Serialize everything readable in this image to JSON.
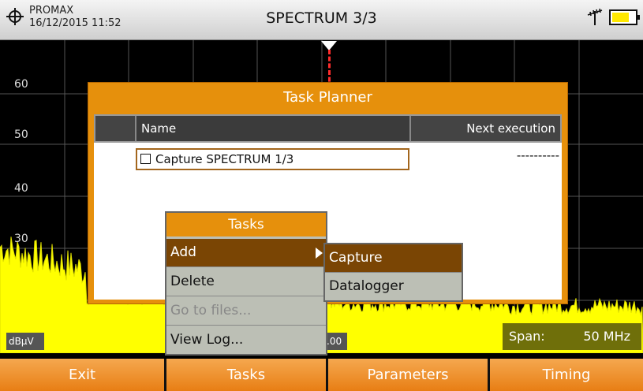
{
  "header": {
    "brand": "PROMAX",
    "datetime": "16/12/2015 11:52",
    "title": "SPECTRUM 3/3"
  },
  "plot": {
    "y_labels": [
      "60",
      "50",
      "40",
      "30"
    ],
    "unit": "dBµV",
    "freq_fragment": ".00",
    "span_label": "Span:",
    "span_value": "50 MHz"
  },
  "task_planner": {
    "title": "Task Planner",
    "columns": {
      "name": "Name",
      "next": "Next execution"
    },
    "rows": [
      {
        "checked": false,
        "name": "Capture SPECTRUM 1/3",
        "next": "----------"
      }
    ]
  },
  "tasks_menu": {
    "title": "Tasks",
    "items": [
      {
        "label": "Add",
        "selected": true,
        "disabled": false
      },
      {
        "label": "Delete",
        "selected": false,
        "disabled": false
      },
      {
        "label": "Go to files...",
        "selected": false,
        "disabled": true
      },
      {
        "label": "View Log...",
        "selected": false,
        "disabled": false
      }
    ]
  },
  "add_submenu": {
    "items": [
      {
        "label": "Capture",
        "selected": true
      },
      {
        "label": "Datalogger",
        "selected": false
      }
    ]
  },
  "footer": {
    "buttons": [
      "Exit",
      "Tasks",
      "Parameters",
      "Timing"
    ]
  },
  "colors": {
    "accent_orange": "#e6900c",
    "selected_brown": "#7a4504",
    "spectrum_yellow": "#ffff00",
    "battery_yellow": "#ffe800"
  },
  "icons": [
    "crosshair-logo-icon",
    "antenna-icon",
    "battery-icon",
    "checkbox-icon",
    "submenu-arrow-icon"
  ]
}
